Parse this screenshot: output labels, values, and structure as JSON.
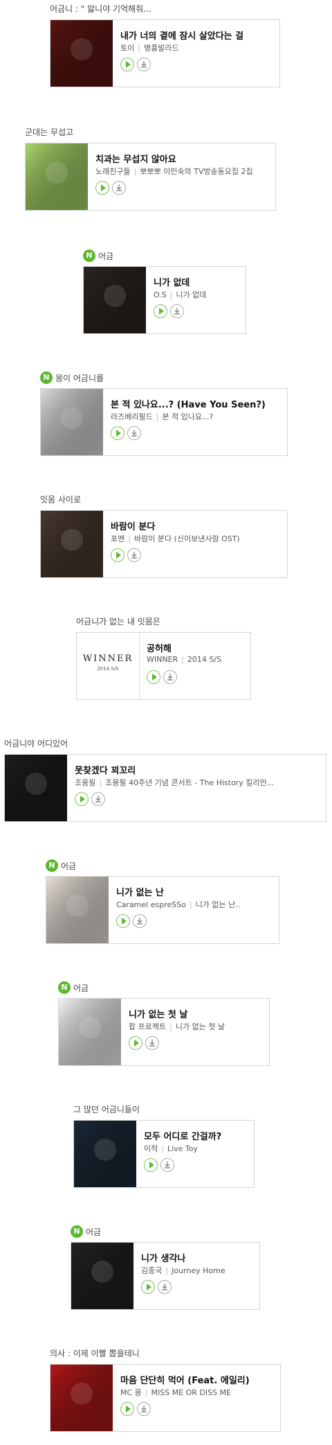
{
  "items": [
    {
      "caption": "어금니 : \" 앓니야 기억해줘...",
      "is_new": false,
      "title": "내가 너의 곁에 잠시 살았다는 걸",
      "artist": "토이",
      "album": "명품발라드",
      "art_color": "#5a1512"
    },
    {
      "caption": "군대는 무섭고",
      "is_new": false,
      "title": "치과는 무섭지 않아요",
      "artist": "노래친구들",
      "album": "뽀뽀뽀 이민숙의 TV방송동요집 2집",
      "art_color": "#a9d66a"
    },
    {
      "caption": "어금",
      "is_new": true,
      "title": "니가 없데",
      "artist": "O.S",
      "album": "니가 없데",
      "art_color": "#2b2522"
    },
    {
      "caption": "몽이 어금니를",
      "is_new": true,
      "title": "본 적 있나요...? (Have You Seen?)",
      "artist": "라즈베리필드",
      "album": "본 적 있나요...?",
      "art_color": "#dcdcdc"
    },
    {
      "caption": "잇몸 사이로",
      "is_new": false,
      "title": "바람이 분다",
      "artist": "포맨",
      "album": "바람이 분다 (신이보낸사람 OST)",
      "art_color": "#4a3a30"
    },
    {
      "caption": "어금니가 없는 내 잇몸은",
      "is_new": false,
      "title": "공허해",
      "artist": "WINNER",
      "album": "2014 S/S",
      "art_color": "#ffffff",
      "art_logo": "WINNER",
      "art_sub": "2014 S/S"
    },
    {
      "caption": "어금니야 어디있어",
      "is_new": false,
      "title": "못찾겠다 꾀꼬리",
      "artist": "조용필",
      "album": "조용필 40주년 기념 콘서트 - The History 킬리만...",
      "art_color": "#1d1d1d"
    },
    {
      "caption": "어금",
      "is_new": true,
      "title": "니가 없는 난",
      "artist": "Caramel espreSSo",
      "album": "니가 없는 난..",
      "art_color": "#e8e2da"
    },
    {
      "caption": "어금",
      "is_new": true,
      "title": "니가 없는 첫 날",
      "artist": "팝 프로젝트",
      "album": "니가 없는 첫 날",
      "art_color": "#f4f4f4"
    },
    {
      "caption": "그 많던 어금니들이",
      "is_new": false,
      "title": "모두 어디로 간걸까?",
      "artist": "이적",
      "album": "Live Toy",
      "art_color": "#1c2838"
    },
    {
      "caption": "어금",
      "is_new": true,
      "title": "니가 생각나",
      "artist": "김종국",
      "album": "Journey Home",
      "art_color": "#222222"
    },
    {
      "caption": "의사 : 이제 이빨 뽑을테니",
      "is_new": false,
      "title": "마음 단단히 먹어 (Feat. 에일리)",
      "artist": "MC 몽",
      "album": "MISS ME OR DISS ME",
      "art_color": "#b01818"
    }
  ],
  "badge_letter": "N",
  "accent_color": "#5cb82f"
}
